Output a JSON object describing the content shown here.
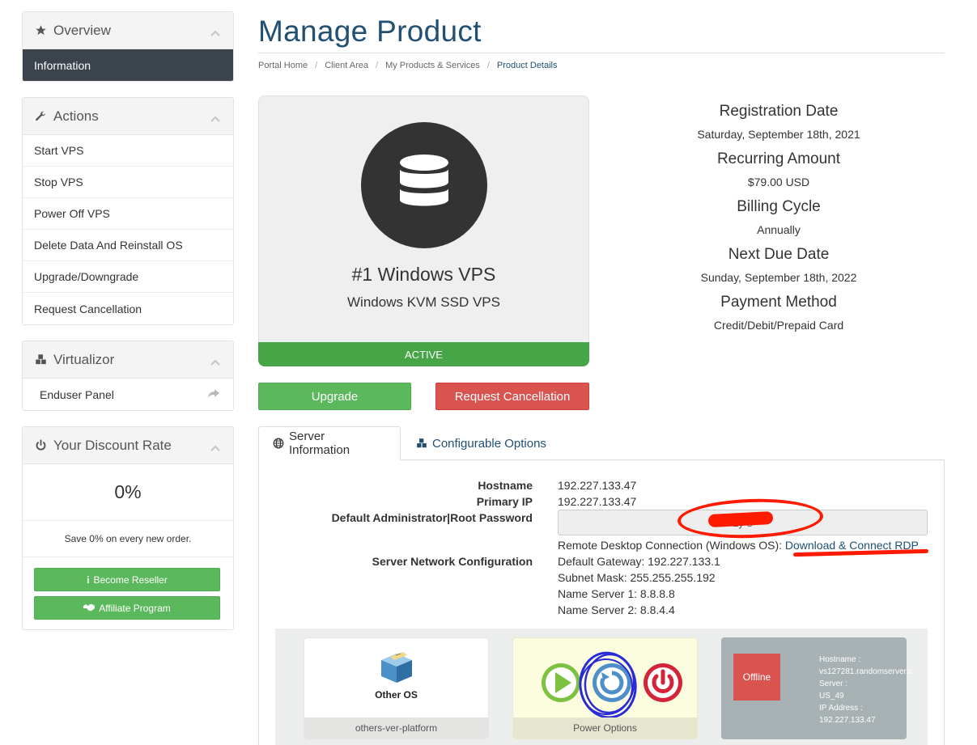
{
  "sidebar": {
    "overview": {
      "title": "Overview",
      "items": [
        {
          "label": "Information"
        }
      ]
    },
    "actions": {
      "title": "Actions",
      "items": [
        {
          "label": "Start VPS"
        },
        {
          "label": "Stop VPS"
        },
        {
          "label": "Power Off VPS"
        },
        {
          "label": "Delete Data And Reinstall OS"
        },
        {
          "label": "Upgrade/Downgrade"
        },
        {
          "label": "Request Cancellation"
        }
      ]
    },
    "virtualizor": {
      "title": "Virtualizor",
      "items": [
        {
          "label": "Enduser Panel"
        }
      ]
    },
    "discount": {
      "title": "Your Discount Rate",
      "value": "0%",
      "note": "Save 0% on every new order.",
      "reseller_button": "Become Reseller",
      "affiliate_button": "Affiliate Program"
    }
  },
  "header": {
    "title": "Manage Product",
    "breadcrumb": [
      "Portal Home",
      "Client Area",
      "My Products & Services",
      "Product Details"
    ]
  },
  "product": {
    "name": "#1 Windows VPS",
    "group": "Windows KVM SSD VPS",
    "status": "ACTIVE",
    "upgrade_button": "Upgrade",
    "cancel_button": "Request Cancellation"
  },
  "billing": {
    "registration_label": "Registration Date",
    "registration_value": "Saturday, September 18th, 2021",
    "recurring_label": "Recurring Amount",
    "recurring_value": "$79.00 USD",
    "cycle_label": "Billing Cycle",
    "cycle_value": "Annually",
    "due_label": "Next Due Date",
    "due_value": "Sunday, September 18th, 2022",
    "payment_label": "Payment Method",
    "payment_value": "Credit/Debit/Prepaid Card"
  },
  "tabs": {
    "server_info": "Server Information",
    "config_options": "Configurable Options"
  },
  "server": {
    "hostname_label": "Hostname",
    "hostname_value": "192.227.133.47",
    "ip_label": "Primary IP",
    "ip_value": "192.227.133.47",
    "password_label": "Default Administrator|Root Password",
    "password_value": "2y        8",
    "rdp_text": "Remote Desktop Connection (Windows OS): ",
    "rdp_link": "Download & Connect RDP",
    "network_label": "Server Network Configuration",
    "gateway": "Default Gateway: 192.227.133.1",
    "subnet": "Subnet Mask: 255.255.255.192",
    "ns1": "Name Server 1: 8.8.8.8",
    "ns2": "Name Server 2: 8.8.4.4"
  },
  "virtualizor_panel": {
    "os_label": "Other OS",
    "os_caption": "others-ver-platform",
    "power_caption": "Power Options",
    "offline_label": "Offline",
    "srv_hostname_label": "Hostname :",
    "srv_hostname_value": "vs127281.randomserver.c",
    "srv_server_label": "Server :",
    "srv_server_value": "US_49",
    "srv_ip_label": "IP Address :",
    "srv_ip_value": "192.227.133.47"
  },
  "colors": {
    "brand": "#215073",
    "active_nav": "#3b434c",
    "success": "#5cb85c",
    "danger": "#d9534f",
    "annotation_red": "#ff1a00",
    "annotation_blue": "#2b2bd6"
  }
}
